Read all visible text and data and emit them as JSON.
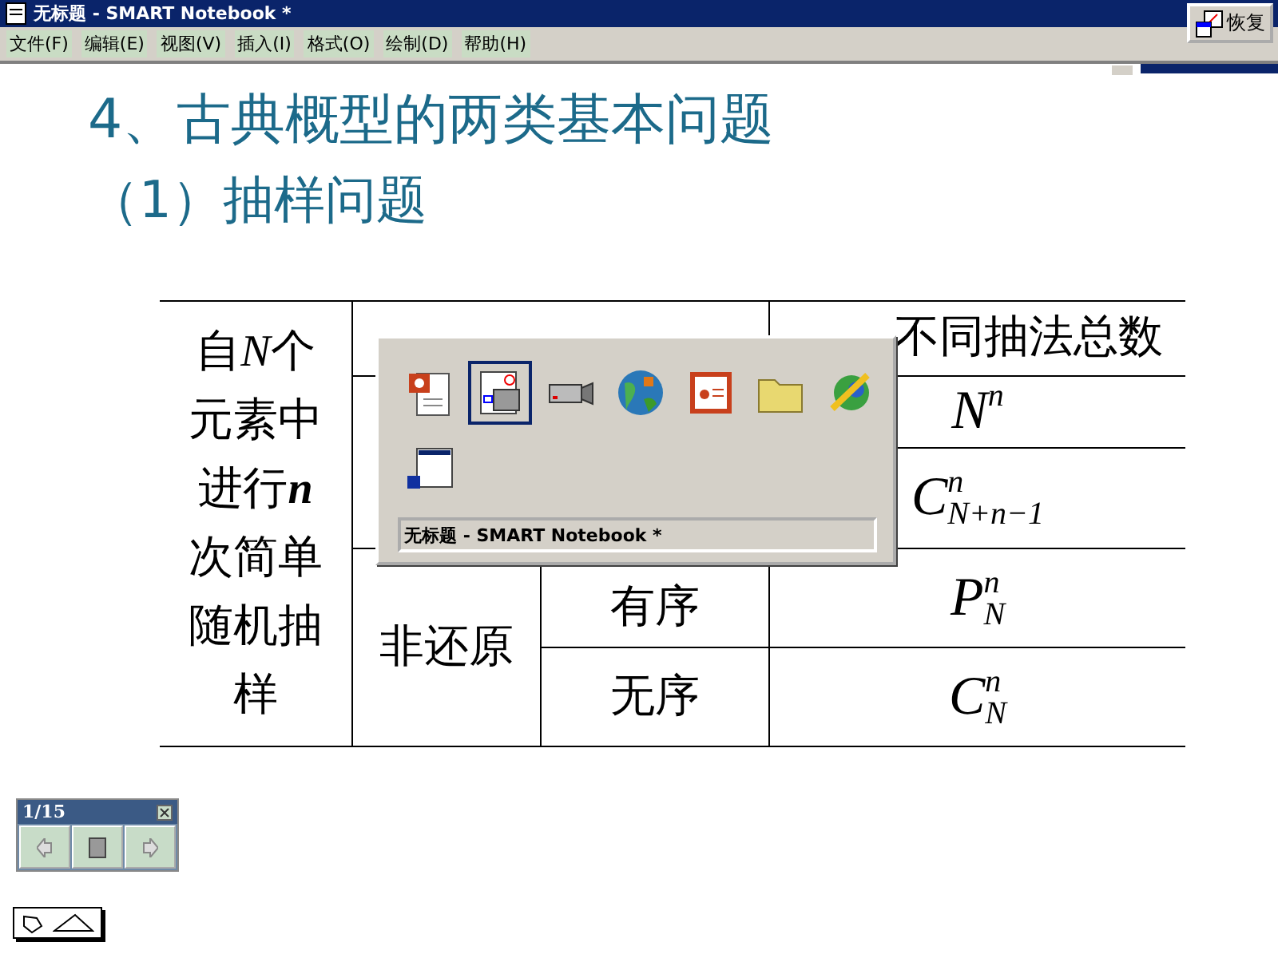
{
  "window": {
    "title": "无标题 - SMART Notebook *",
    "restore_button": "恢复"
  },
  "menu": [
    "文件(F)",
    "编辑(E)",
    "视图(V)",
    "插入(I)",
    "格式(O)",
    "绘制(D)",
    "帮助(H)"
  ],
  "slide": {
    "title": "4、古典概型的两类基本问题",
    "subtitle": "（1）抽样问题",
    "table": {
      "row_header": [
        {
          "text": "自"
        },
        {
          "text": "N",
          "kind": "variable"
        },
        {
          "text": "个元素中进行"
        },
        {
          "text": "n",
          "kind": "count"
        },
        {
          "text": "次简单随机抽样"
        }
      ],
      "header": [
        "不同抽法总数"
      ],
      "with_replacement": {
        "counts": [
          {
            "base": "N",
            "sup": "n"
          },
          {
            "base": "C",
            "sup": "n",
            "sub": "N+n−1"
          }
        ]
      },
      "without_replacement": {
        "label": "非还原",
        "orders": [
          "有序",
          "无序"
        ],
        "counts": [
          {
            "base": "P",
            "sup": "n",
            "sub": "N"
          },
          {
            "base": "C",
            "sup": "n",
            "sub": "N"
          }
        ]
      }
    }
  },
  "switcher": {
    "apps": [
      {
        "kind": "document",
        "selected": false
      },
      {
        "kind": "notebook",
        "selected": true
      },
      {
        "kind": "camera",
        "selected": false
      },
      {
        "kind": "globe",
        "selected": false
      },
      {
        "kind": "presentation",
        "selected": false
      },
      {
        "kind": "folder",
        "selected": false
      },
      {
        "kind": "network",
        "selected": false
      },
      {
        "kind": "window",
        "selected": false
      }
    ],
    "caption": "无标题 - SMART Notebook *"
  },
  "page_navigator": {
    "page": "1/15"
  }
}
